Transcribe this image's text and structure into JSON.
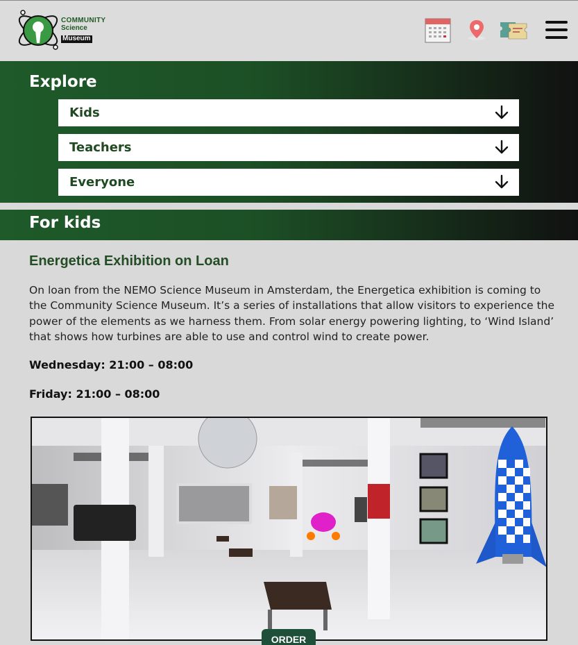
{
  "header": {
    "logo": {
      "line1": "COMMUNITY",
      "line2": "Science",
      "line3": "Museum"
    },
    "icons": [
      "calendar-icon",
      "location-pin-icon",
      "tickets-icon",
      "hamburger-menu-icon"
    ]
  },
  "explore": {
    "title": "Explore",
    "items": [
      {
        "label": "Kids"
      },
      {
        "label": "Teachers"
      },
      {
        "label": "Everyone"
      }
    ]
  },
  "for_kids": {
    "title": "For kids",
    "event": {
      "title": "Energetica Exhibition on Loan",
      "description": "On loan from the NEMO Science Museum in Amsterdam, the Energetica exhibition is coming to the Community Science Museum. It’s a series of installations that allow visitors to experience the power of the elements as we harness them. From solar energy powering lighting, to ‘Wind Island’ that shows how turbines are able to use and control wind to create power.",
      "hours": [
        "Wednesday: 21:00 – 08:00",
        "Friday: 21:00 – 08:00"
      ],
      "order_label": "ORDER"
    }
  },
  "colors": {
    "green_dark": "#1e5a2a",
    "order_button": "#1d4f39",
    "background": "#d9d9d9"
  }
}
